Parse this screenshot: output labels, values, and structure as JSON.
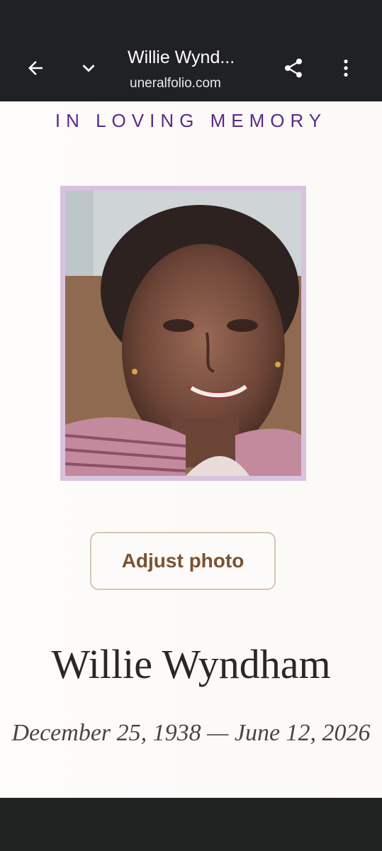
{
  "browser": {
    "tab_title": "Willie Wynd...",
    "url": "uneralfolio.com",
    "icons": {
      "back": "arrow-left-icon",
      "collapse": "chevron-down-icon",
      "share": "share-icon",
      "menu": "more-vert-icon"
    }
  },
  "page": {
    "heading": "IN LOVING MEMORY",
    "photo_alt": "Portrait of Willie Wyndham",
    "adjust_label": "Adjust photo",
    "name": "Willie Wyndham",
    "dates": "December 25, 1938 — June 12, 2026"
  },
  "colors": {
    "toolbar_bg": "#202124",
    "heading": "#5b2a86",
    "frame": "#d9c2de",
    "button_text": "#7a5232",
    "button_border": "#d7c5b3"
  }
}
